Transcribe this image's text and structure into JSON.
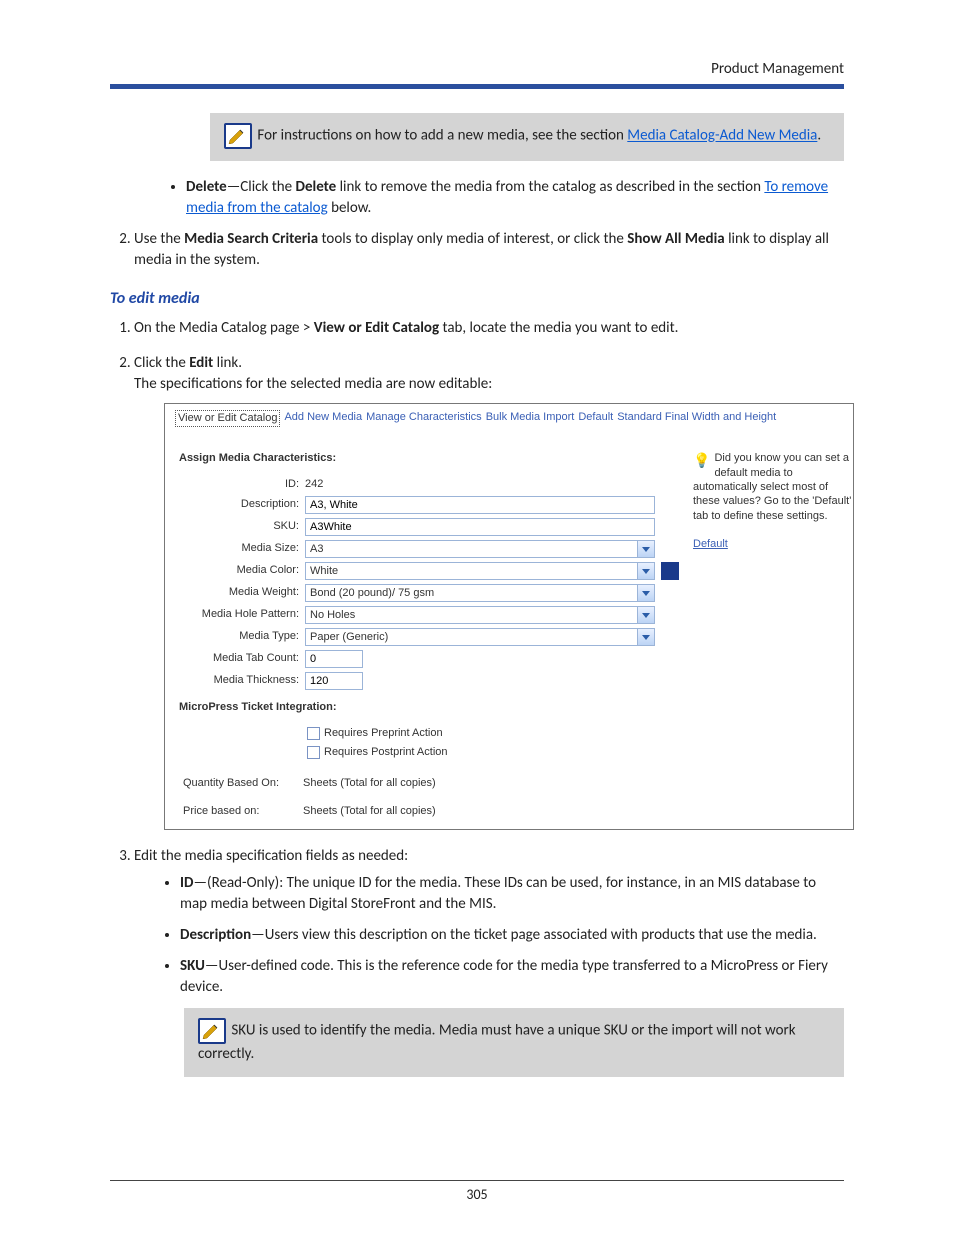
{
  "header": {
    "title": "Product Management"
  },
  "note1": {
    "prefix": "For instructions on how to add a new media, see the section ",
    "link": "Media Catalog-Add New Media",
    "suffix": "."
  },
  "delete_bullet": {
    "lead": "Delete",
    "dash": "—Click the ",
    "deleteword": "Delete",
    "after": " link to remove the media from the catalog as described in the section ",
    "link": "To remove media from the catalog",
    "tail": " below."
  },
  "step_use": {
    "pre": "Use the ",
    "bold1": "Media Search Criteria",
    "mid": " tools to display only media of interest, or click the ",
    "bold2": "Show All Media",
    "post": " link to display all media in the system."
  },
  "heading_edit": "To edit media",
  "edit_steps": {
    "s1_pre": "On the Media Catalog page > ",
    "s1_bold": "View or Edit Catalog",
    "s1_post": " tab, locate the media you want to edit.",
    "s2_pre": "Click the ",
    "s2_bold": "Edit",
    "s2_post": " link.",
    "s2_line2": "The specifications for the selected media are now editable:",
    "s3": "Edit the media specification fields as needed:"
  },
  "screenshot": {
    "tabs": [
      "View or Edit Catalog",
      "Add New Media",
      "Manage Characteristics",
      "Bulk Media Import",
      "Default",
      "Standard Final Width and Height"
    ],
    "assign_title": "Assign Media Characteristics:",
    "labels": {
      "id": "ID:",
      "desc": "Description:",
      "sku": "SKU:",
      "size": "Media Size:",
      "color": "Media Color:",
      "weight": "Media Weight:",
      "hole": "Media Hole Pattern:",
      "type": "Media Type:",
      "tab": "Media Tab Count:",
      "thick": "Media Thickness:"
    },
    "values": {
      "id": "242",
      "desc": "A3, White",
      "sku": "A3White",
      "size": "A3",
      "color": "White",
      "weight": "Bond (20 pound)/ 75 gsm",
      "hole": "No Holes",
      "type": "Paper (Generic)",
      "tab": "0",
      "thick": "120"
    },
    "tip": {
      "text": "Did you know you can set a default media to automatically select most of these values? Go to the 'Default' tab to define these settings.",
      "link": "Default"
    },
    "micropress_title": "MicroPress Ticket Integration:",
    "chk1": "Requires Preprint Action",
    "chk2": "Requires Postprint Action",
    "foot1_label": "Quantity Based On:",
    "foot1_val": "Sheets (Total for all copies)",
    "foot2_label": "Price based on:",
    "foot2_val": "Sheets (Total for all copies)"
  },
  "fields_list": {
    "id": {
      "name": "ID",
      "text": "—(Read-Only): The unique ID for the media. These IDs can be used, for instance, in an MIS database to map media between Digital StoreFront and the MIS."
    },
    "desc": {
      "name": "Description",
      "text": "—Users view this description on the ticket page associated with products that use the media."
    },
    "sku": {
      "name": "SKU",
      "text": "—User-defined code. This is the reference code for the media type transferred to a MicroPress or Fiery device."
    }
  },
  "note2": {
    "text": "SKU is used to identify the media. Media must have a unique SKU or the import will not work correctly."
  },
  "page_number": "305"
}
